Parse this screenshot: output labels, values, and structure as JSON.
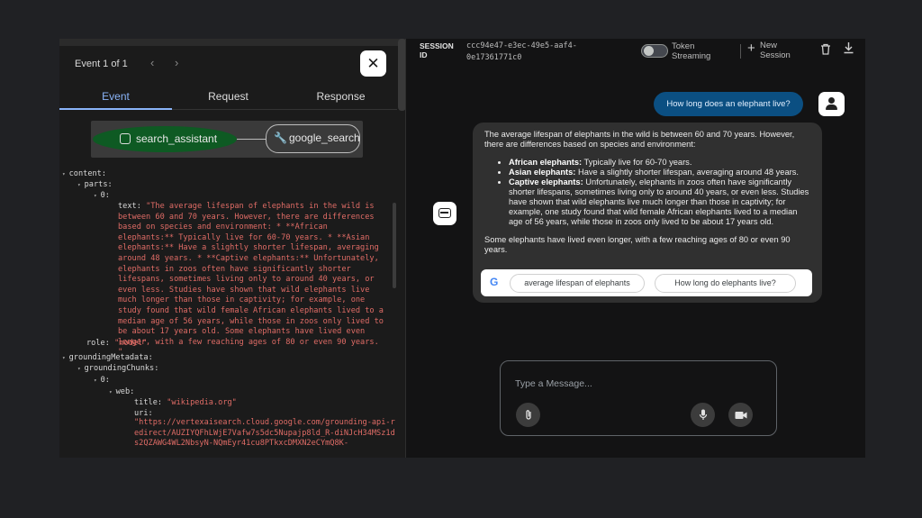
{
  "left_panel": {
    "event_counter": "Event 1 of 1",
    "prev_arrow": "‹",
    "next_arrow": "›",
    "close_glyph": "✕",
    "tabs": [
      {
        "label": "Event",
        "active": true
      },
      {
        "label": "Request",
        "active": false
      },
      {
        "label": "Response",
        "active": false
      }
    ],
    "graph": {
      "node_agent": "search_assistant",
      "node_tool": "google_search"
    },
    "tree": {
      "content_key": "content:",
      "parts_key": "parts:",
      "index_0": "0:",
      "text_key": "text:",
      "text_value": "\"The average lifespan of elephants in the wild is between 60 and 70 years. However, there are differences based on species and environment: * **African elephants:** Typically live for 60-70 years. * **Asian elephants:** Have a slightly shorter lifespan, averaging around 48 years. * **Captive elephants:** Unfortunately, elephants in zoos often have significantly shorter lifespans, sometimes living only to around 40 years, or even less. Studies have shown that wild elephants live much longer than those in captivity; for example, one study found that wild female African elephants lived to a median age of 56 years, while those in zoos only lived to be about 17 years old. Some elephants have lived even longer, with a few reaching ages of 80 or even 90 years. \"",
      "role_key": "role:",
      "role_value": "\"model\"",
      "grounding_key": "groundingMetadata:",
      "chunks_key": "groundingChunks:",
      "chunk_index": "0:",
      "web_key": "web:",
      "title_key": "title:",
      "title_value": "\"wikipedia.org\"",
      "uri_key": "uri:",
      "uri_value": "\"https://vertexaisearch.cloud.google.com/grounding-api-redirect/AUZIYQFhLWjE7Vafw7s5dc5Nupajp8ld_R-diNJcH34MSz1ds2QZAWG4WL2NbsyN-NQmEyr41cu8PTkxcDMXN2eCYmQ8K-"
    }
  },
  "right_panel": {
    "session_label": "SESSION ID",
    "session_id": "ccc94e47-e3ec-49e5-aaf4-0e17361771c0",
    "token_streaming_label": "Token Streaming",
    "new_session_label": "New Session",
    "user_message": "How long does an elephant live?",
    "bot_message": {
      "intro": "The average lifespan of elephants in the wild is between 60 and 70 years. However, there are differences based on species and environment:",
      "bullets": [
        {
          "bold": "African elephants:",
          "text": " Typically live for 60-70 years."
        },
        {
          "bold": "Asian elephants:",
          "text": " Have a slightly shorter lifespan, averaging around 48 years."
        },
        {
          "bold": "Captive elephants:",
          "text": " Unfortunately, elephants in zoos often have significantly shorter lifespans, sometimes living only to around 40 years, or even less. Studies have shown that wild elephants live much longer than those in captivity; for example, one study found that wild female African elephants lived to a median age of 56 years, while those in zoos only lived to be about 17 years old."
        }
      ],
      "outro": "Some elephants have lived even longer, with a few reaching ages of 80 or even 90 years."
    },
    "suggestions": [
      "average lifespan of elephants",
      "How long do elephants live?"
    ],
    "google_logo": "G",
    "input_placeholder": "Type a Message..."
  }
}
